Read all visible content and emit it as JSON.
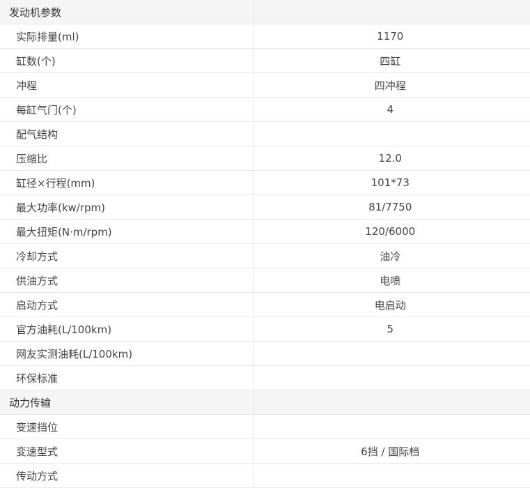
{
  "sections": [
    {
      "title": "发动机参数",
      "rows": [
        {
          "label": "实际排量(ml)",
          "value": "1170"
        },
        {
          "label": "缸数(个)",
          "value": "四缸"
        },
        {
          "label": "冲程",
          "value": "四冲程"
        },
        {
          "label": "每缸气门(个)",
          "value": "4"
        },
        {
          "label": "配气结构",
          "value": ""
        },
        {
          "label": "压缩比",
          "value": "12.0"
        },
        {
          "label": "缸径×行程(mm)",
          "value": "101*73"
        },
        {
          "label": "最大功率(kw/rpm)",
          "value": "81/7750"
        },
        {
          "label": "最大扭矩(N·m/rpm)",
          "value": "120/6000"
        },
        {
          "label": "冷却方式",
          "value": "油冷"
        },
        {
          "label": "供油方式",
          "value": "电喷"
        },
        {
          "label": "启动方式",
          "value": "电启动"
        },
        {
          "label": "官方油耗(L/100km)",
          "value": "5"
        },
        {
          "label": "网友实测油耗(L/100km)",
          "value": ""
        },
        {
          "label": "环保标准",
          "value": ""
        }
      ]
    },
    {
      "title": "动力传输",
      "rows": [
        {
          "label": "变速挡位",
          "value": ""
        },
        {
          "label": "变速型式",
          "value": "6挡 / 国际档"
        },
        {
          "label": "传动方式",
          "value": ""
        }
      ]
    }
  ]
}
